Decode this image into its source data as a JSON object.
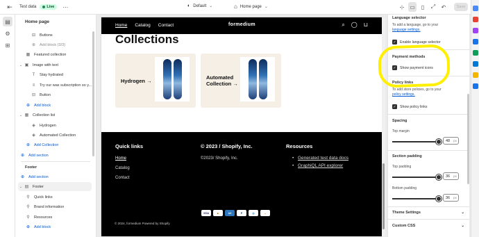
{
  "topbar": {
    "store_name": "Test data",
    "live_badge": "Live",
    "theme_selector": "Default",
    "page_selector": "Home page",
    "save_label": "Save"
  },
  "sidebar": {
    "title": "Home page",
    "rows": {
      "buttons": "Buttons",
      "add_block_limit": "Add block (3/3)",
      "featured_collection": "Featured collection",
      "image_with_text": "Image with text",
      "stay_hydrated": "Stay hydrated",
      "try_our_wax": "Try our wax subscription so y...",
      "button": "Button",
      "add_block_1": "Add block",
      "collection_list": "Collection list",
      "hydrogen": "Hydrogen",
      "automated_collection": "Automated Collection",
      "add_collection": "Add Collection",
      "add_section_1": "Add section",
      "footer_group": "Footer",
      "add_section_2": "Add section",
      "footer": "Footer",
      "quick_links": "Quick links",
      "brand_information": "Brand information",
      "resources": "Resources",
      "add_block_2": "Add block"
    }
  },
  "preview": {
    "nav": [
      "Home",
      "Catalog",
      "Contact"
    ],
    "logo": "formedium",
    "heading": "Collections",
    "cards": [
      {
        "title": "Hydrogen →"
      },
      {
        "title_line1": "Automated",
        "title_line2": "Collection →"
      }
    ],
    "footer": {
      "quick_links_heading": "Quick links",
      "quick_links": [
        "Home",
        "Catalog",
        "Contact"
      ],
      "brand_heading": "© 2023 / Shopify, Inc.",
      "brand_text": "©2023/ Shopify, Inc.",
      "resources_heading": "Resources",
      "resources": [
        "Generated test data docs",
        "GraphiQL API explorer"
      ],
      "payment_icons": [
        "VISA",
        "MC",
        "AMEX",
        "PayPal",
        "DC",
        "DISC"
      ],
      "copyright": "© 2024, formedium Powered by Shopify"
    }
  },
  "settings": {
    "language_selector_heading": "Language selector",
    "language_text": "To add a language, go to your",
    "language_link": "language settings.",
    "enable_language_selector": "Enable language selector",
    "payment_methods_heading": "Payment methods",
    "show_payment_icons": "Show payment icons",
    "policy_links_heading": "Policy links",
    "policy_text": "To add store policies, go to your",
    "policy_link": "policy settings.",
    "show_policy_links": "Show policy links",
    "spacing_heading": "Spacing",
    "top_margin_label": "Top margin",
    "top_margin_value": "48",
    "top_margin_unit": "px",
    "section_padding_heading": "Section padding",
    "top_padding_label": "Top padding",
    "top_padding_value": "36",
    "top_padding_unit": "px",
    "bottom_padding_label": "Bottom padding",
    "bottom_padding_value": "36",
    "bottom_padding_unit": "px",
    "theme_settings": "Theme Settings",
    "custom_css": "Custom CSS"
  }
}
